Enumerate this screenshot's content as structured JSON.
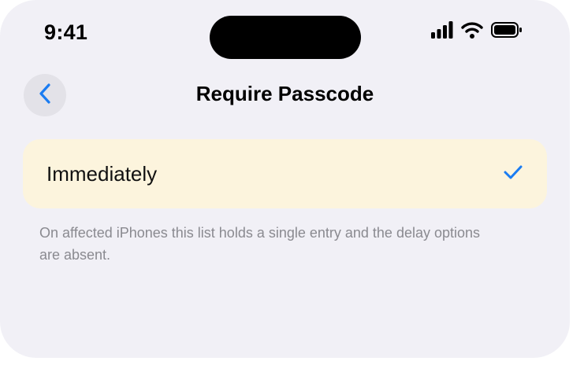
{
  "status_bar": {
    "time": "9:41"
  },
  "nav": {
    "back_icon": "chevron-left-icon",
    "title": "Require Passcode"
  },
  "options": [
    {
      "label": "Immediately",
      "selected": true
    }
  ],
  "footer": {
    "note": "On affected iPhones this list holds a single entry and the delay options are absent."
  },
  "colors": {
    "accent": "#1a7cf2",
    "background": "#f1f0f6",
    "selected_row": "#fcf4dd",
    "back_button": "#e3e2e8",
    "footer_text": "#8a8a90"
  }
}
